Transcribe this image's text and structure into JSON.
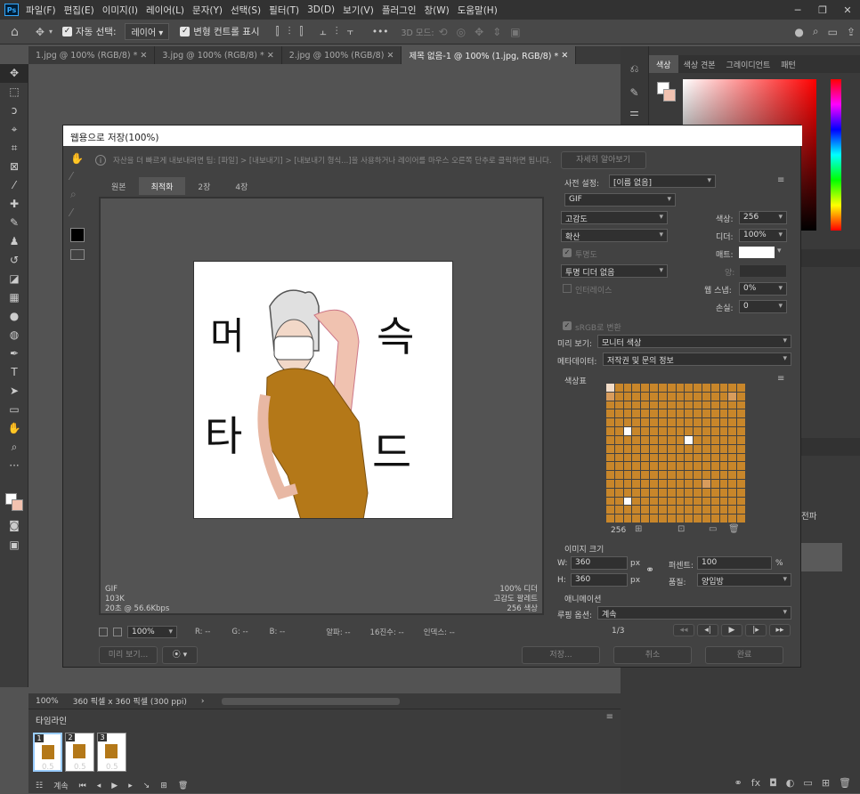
{
  "app": {
    "logo": "Ps"
  },
  "menu": [
    "파일(F)",
    "편집(E)",
    "이미지(I)",
    "레이어(L)",
    "문자(Y)",
    "선택(S)",
    "필터(T)",
    "3D(D)",
    "보기(V)",
    "플러그인",
    "창(W)",
    "도움말(H)"
  ],
  "window_controls": {
    "minimize": "─",
    "restore": "❐",
    "close": "✕"
  },
  "options": {
    "auto_select": "자동 선택:",
    "layer_select": "레이어",
    "transform_controls": "변형 컨트롤 표시",
    "more": "•••",
    "mode_3d": "3D 모드:"
  },
  "tabs": [
    {
      "label": "1.jpg @ 100% (RGB/8) *",
      "close": "✕"
    },
    {
      "label": "3.jpg @ 100% (RGB/8) *",
      "close": "✕"
    },
    {
      "label": "2.jpg @ 100% (RGB/8)",
      "close": "✕"
    },
    {
      "label": "제목 없음-1 @ 100% (1.jpg, RGB/8) *",
      "close": "✕"
    }
  ],
  "right_panel": {
    "tabs": [
      "색상",
      "색상 견본",
      "그레이디언트",
      "패턴"
    ],
    "partial_text": "전파"
  },
  "dialog": {
    "title": "웹용으로 저장(100%)",
    "tip": "자산을 더 빠르게 내보내려면 팁: [파일] > [내보내기] > [내보내기 형식...]을 사용하거나 레이어를 마우스 오른쪽 단추로 클릭하면 됩니다.",
    "learn_more": "자세히 알아보기",
    "view_tabs": [
      "원본",
      "최적화",
      "2장",
      "4장"
    ],
    "preview_info": {
      "format": "GIF",
      "size": "103K",
      "time": "20초 @ 56.6Kbps",
      "dither": "100% 디더",
      "palette": "고감도 팔레트",
      "colors": "256 색상"
    },
    "artwork_text": {
      "a": "머",
      "b": "슥",
      "c": "타",
      "d": "드"
    },
    "status": {
      "zoom": "100%",
      "r": "R: --",
      "g": "G: --",
      "b": "B: --",
      "alpha": "알파: --",
      "hex": "16진수: --",
      "index": "인덱스: --"
    },
    "settings": {
      "preset_label": "사전 설정:",
      "preset_value": "[이름 없음]",
      "format": "GIF",
      "reduction": "고감도",
      "colors_label": "색상:",
      "colors_value": "256",
      "dither_algo": "확산",
      "dither_label": "디더:",
      "dither_value": "100%",
      "transparency": "투명도",
      "matte_label": "매트:",
      "trans_dither": "투명 디더 없음",
      "amount_label": "양:",
      "interlace": "인터레이스",
      "websnap_label": "웹 스냅:",
      "websnap_value": "0%",
      "lossy_label": "손실:",
      "lossy_value": "0",
      "srgb": "sRGB로 변환",
      "preview_label": "미리 보기:",
      "preview_value": "모니터 색상",
      "metadata_label": "메타데이터:",
      "metadata_value": "저작권 및 문의 정보",
      "color_table": "색상표",
      "color_count": "256",
      "image_size": "이미지 크기",
      "w_label": "W:",
      "w_value": "360",
      "h_label": "H:",
      "h_value": "360",
      "px": "px",
      "percent_label": "퍼센트:",
      "percent_value": "100",
      "pct": "%",
      "quality_label": "품질:",
      "quality_value": "양입방",
      "animation": "애니메이션",
      "loop_label": "루핑 옵션:",
      "loop_value": "계속",
      "frame_counter": "1/3"
    },
    "buttons": {
      "preview": "미리 보기...",
      "save": "저장...",
      "cancel": "취소",
      "done": "완료"
    }
  },
  "status_bar": {
    "zoom": "100%",
    "doc_info": "360 픽셀 x 360 픽셀 (300 ppi)"
  },
  "timeline": {
    "title": "타임라인",
    "frames": [
      {
        "num": "1",
        "delay": "0.5"
      },
      {
        "num": "2",
        "delay": "0.5"
      },
      {
        "num": "3",
        "delay": "0.5"
      }
    ],
    "loop": "계속"
  },
  "colors": {
    "palette": [
      "#c8862a",
      "#e8c2a8",
      "#1e1e1e",
      "#aaaaaa",
      "#f2dcc8",
      "#e8a898",
      "#b47818",
      "#5a5a5a",
      "#d89c5c",
      "#ffffff",
      "#8a5a22",
      "#c4c4c4",
      "#f0b8a8",
      "#9a6a22",
      "#3a3a3a",
      "#dcaa78"
    ]
  }
}
